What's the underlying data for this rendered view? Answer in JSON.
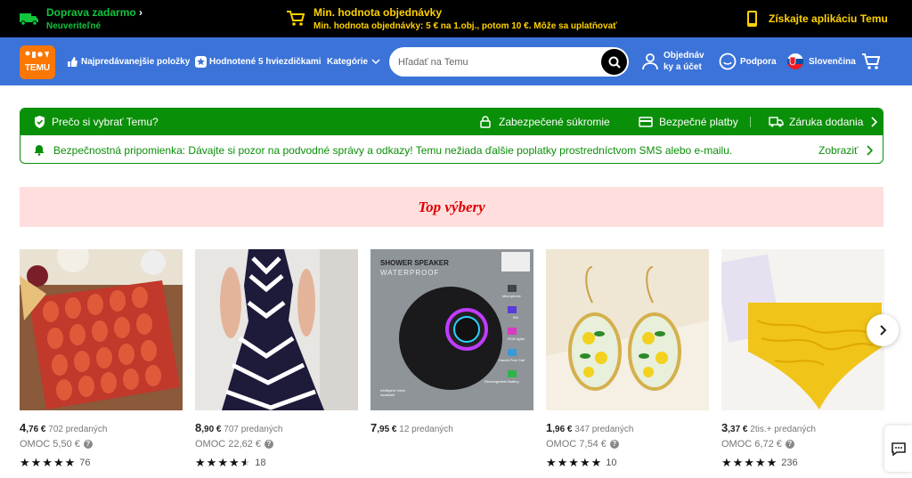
{
  "promo": {
    "shipping_title": "Doprava zadarmo",
    "shipping_sub": "Neuveriteľné",
    "min_title": "Min. hodnota objednávky",
    "min_sub": "Min. hodnota objednávky: 5 € na 1.obj., potom 10 €. Môže sa uplatňovať",
    "app": "Získajte aplikáciu Temu"
  },
  "nav": {
    "logo": "TEMU",
    "bestsellers": "Najpredávanejšie položky",
    "five_star": "Hodnotené 5 hviezdičkami",
    "categories": "Kategórie",
    "search_placeholder": "Hľadať na Temu",
    "account_line1": "Objednáv",
    "account_line2": "ky a účet",
    "support": "Podpora",
    "language": "Slovenčina"
  },
  "trust": {
    "why": "Prečo si vybrať Temu?",
    "privacy": "Zabezpečené súkromie",
    "payments": "Bezpečné platby",
    "delivery": "Záruka dodania",
    "reminder": "Bezpečnostná pripomienka: Dávajte si pozor na podvodné správy a odkazy! Temu nežiada ďalšie poplatky prostredníctvom SMS alebo e-mailu.",
    "show": "Zobraziť"
  },
  "section_title": "Top výbery",
  "products": [
    {
      "price_int": "4",
      "price_dec": ",76 €",
      "sold": "702 predaných",
      "omoc": "OMOC 5,50 €",
      "rating": 5,
      "reviews": "76",
      "stars": "★★★★★"
    },
    {
      "price_int": "8",
      "price_dec": ",90 €",
      "sold": "707 predaných",
      "omoc": "OMOC 22,62 €",
      "rating": 4.5,
      "reviews": "18",
      "stars": "★★★★★"
    },
    {
      "price_int": "7",
      "price_dec": ",95 €",
      "sold": "12 predaných",
      "omoc": "",
      "rating": null,
      "reviews": "",
      "stars": "",
      "image_text": {
        "title": "SHOWER SPEAKER",
        "sub": "WATERPROOF",
        "f1": "Microphone",
        "f2": "5W",
        "f3": "RGB lights",
        "f4": "Hands Free Call",
        "f5": "Rechargeable Battery",
        "f6": "Intelligent Voice Assistant"
      }
    },
    {
      "price_int": "1",
      "price_dec": ",96 €",
      "sold": "347 predaných",
      "omoc": "OMOC 7,54 €",
      "rating": 5,
      "reviews": "10",
      "stars": "★★★★★"
    },
    {
      "price_int": "3",
      "price_dec": ",37 €",
      "sold": "2tis.+ predaných",
      "omoc": "OMOC 6,72 €",
      "rating": 5,
      "reviews": "236",
      "stars": "★★★★★"
    }
  ],
  "colors": {
    "nav_bg": "#3b73d8",
    "trust_green": "#0a8f08",
    "promo_bg": "#000000",
    "accent_yellow": "#ffd200",
    "accent_green": "#11c53d",
    "banner_bg": "#ffdede",
    "banner_text": "#e00000"
  }
}
